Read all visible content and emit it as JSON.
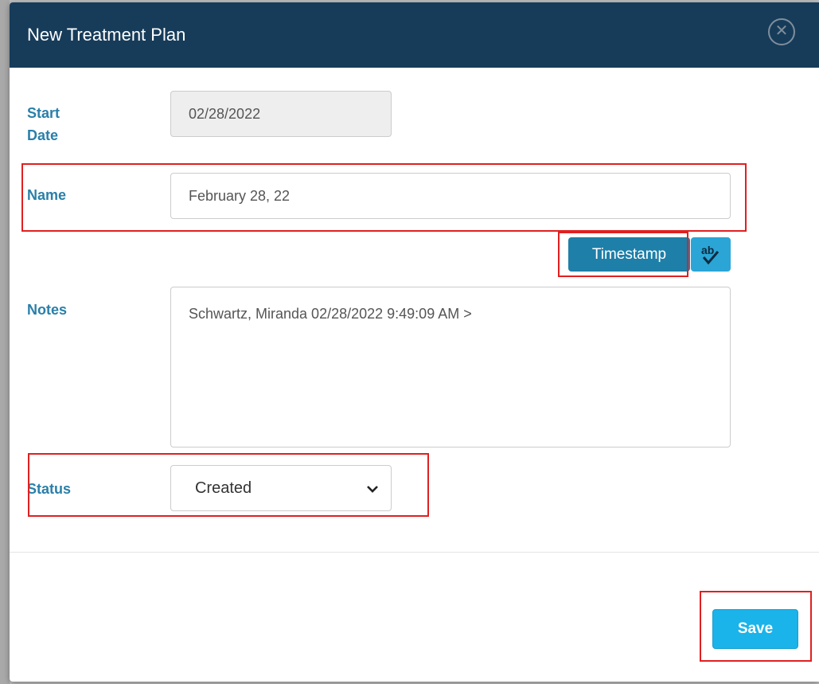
{
  "dialog": {
    "title": "New Treatment Plan",
    "close_icon": "close-circle-icon"
  },
  "form": {
    "start_date": {
      "label_line1": "Start",
      "label_line2": "Date",
      "value": "02/28/2022"
    },
    "name": {
      "label": "Name",
      "value": "February 28, 22"
    },
    "timestamp_button": "Timestamp",
    "spellcheck_icon": "spellcheck-icon",
    "notes": {
      "label": "Notes",
      "value": "Schwartz, Miranda 02/28/2022 9:49:09 AM >"
    },
    "status": {
      "label": "Status",
      "selected": "Created"
    }
  },
  "footer": {
    "save_label": "Save"
  },
  "colors": {
    "header_bg": "#173c5a",
    "label": "#2a7fa9",
    "timestamp_btn": "#1e7fa8",
    "save_btn": "#1ab3ea",
    "highlight": "#e02020"
  }
}
